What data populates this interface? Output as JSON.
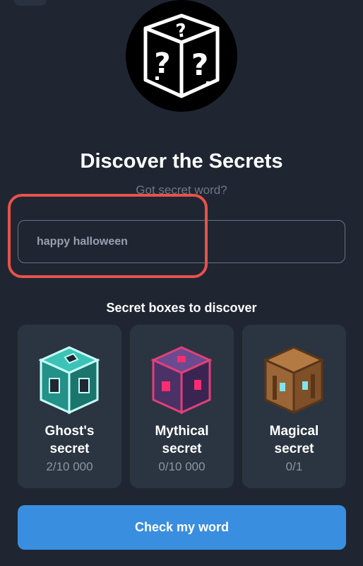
{
  "hero": {
    "icon": "mystery-box-icon"
  },
  "title": "Discover the Secrets",
  "subtitle": "Got secret word?",
  "word_input": {
    "value": "happy halloween",
    "placeholder": ""
  },
  "section_title": "Secret boxes to discover",
  "boxes": [
    {
      "name_line1": "Ghost's",
      "name_line2": "secret",
      "count": "2/10 000",
      "icon": "ghost-box-icon",
      "color": "#2aa39a"
    },
    {
      "name_line1": "Mythical",
      "name_line2": "secret",
      "count": "0/10 000",
      "icon": "mythical-box-icon",
      "color": "#5a3a78"
    },
    {
      "name_line1": "Magical",
      "name_line2": "secret",
      "count": "0/1",
      "icon": "magical-box-icon",
      "color": "#9a6638"
    }
  ],
  "check_button": "Check my word",
  "colors": {
    "background": "#1f2632",
    "card": "#2b3441",
    "accent": "#3a8ee0",
    "highlight": "#e8524a"
  }
}
